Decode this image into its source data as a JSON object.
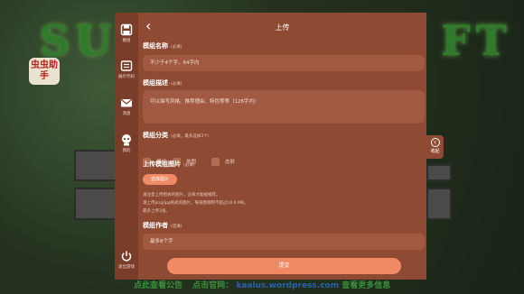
{
  "background": {
    "logo_text": "虫虫助手",
    "footer_a": "点此查看公告",
    "footer_b": "点击官网：",
    "footer_url": "kaalus.wordpress.com",
    "footer_c": "查看更多信息"
  },
  "sidebar": {
    "items": [
      {
        "label": "模组",
        "icon": "save-icon"
      },
      {
        "label": "展示代码",
        "icon": "code-card-icon"
      },
      {
        "label": "消息",
        "icon": "mail-icon"
      },
      {
        "label": "我的",
        "icon": "robot-icon"
      }
    ],
    "logout_label": "退出游戏"
  },
  "header": {
    "back_icon": "‹",
    "title": "上传"
  },
  "form": {
    "name_label": "模组名称",
    "name_hint": "(必填)",
    "name_placeholder": "不少于4个字，64字内",
    "desc_label": "模组描述",
    "desc_hint": "(必填)",
    "desc_placeholder": "可以描写风格、推荐理由、特色等等（128字内）",
    "category_label": "模组分类",
    "category_hint": "(必填，最多选择3个)",
    "categories": [
      "模组",
      "地图",
      "皮肤"
    ],
    "image_label": "上传模组图片",
    "image_hint": "(必填)",
    "choose_button": "选择图片",
    "notes": [
      "请注意上传相关的图片，这样才能被推荐。",
      "请上传png/jpg格式的图片，每张图限制不超过10.0 MB。",
      "最多上传3张。"
    ],
    "author_label": "模组作者",
    "author_hint": "(选填)",
    "author_placeholder": "最多8个字",
    "submit_label": "提交"
  },
  "collapse": {
    "label": "收起"
  },
  "colors": {
    "panel": "#8e4a33",
    "accent": "#ef8a64",
    "sidebar": "#7a3d29"
  }
}
